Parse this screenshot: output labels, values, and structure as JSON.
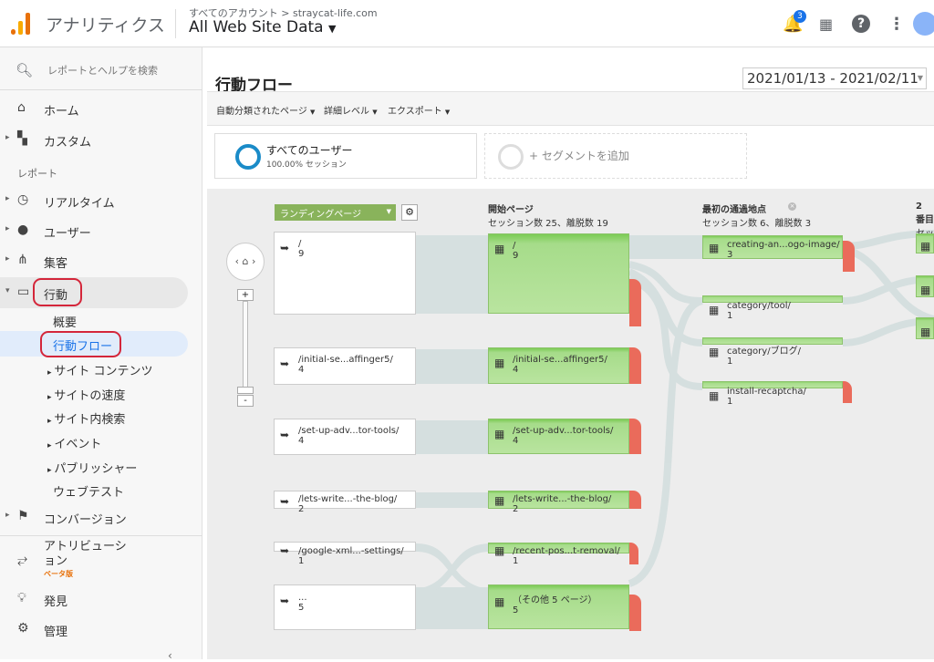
{
  "header": {
    "app_title": "アナリティクス",
    "account_path": "すべてのアカウント > straycat-life.com",
    "property": "All Web Site Data",
    "notification_count": "3"
  },
  "sidebar": {
    "search_placeholder": "レポートとヘルプを検索",
    "home": "ホーム",
    "custom": "カスタム",
    "reports_heading": "レポート",
    "realtime": "リアルタイム",
    "audience": "ユーザー",
    "acquisition": "集客",
    "behavior": "行動",
    "behavior_sub": [
      "概要",
      "行動フロー",
      "サイト コンテンツ",
      "サイトの速度",
      "サイト内検索",
      "イベント",
      "パブリッシャー",
      "ウェブテスト"
    ],
    "conversions": "コンバージョン",
    "attribution": "アトリビューション",
    "attribution_badge": "ベータ版",
    "discover": "発見",
    "admin": "管理"
  },
  "page": {
    "title": "行動フロー",
    "date_range": "2021/01/13 - 2021/02/11"
  },
  "toolbar": {
    "auto_pages": "自動分類されたページ",
    "detail_level": "詳細レベル",
    "export": "エクスポート"
  },
  "segments": {
    "all_users": "すべてのユーザー",
    "all_users_pct": "100.00% セッション",
    "add_segment": "+ セグメントを追加"
  },
  "flow": {
    "landing_dropdown": "ランディングページ",
    "col_start_title": "開始ページ",
    "col_start_stats": "セッション数 25、離脱数 19",
    "col_first_title": "最初の通過地点",
    "col_first_stats": "セッション数 6、離脱数 3",
    "col_second_title": "2 番目",
    "col_second_stats": "セッ",
    "landing_nodes": [
      {
        "label": "/",
        "value": "9"
      },
      {
        "label": "/initial-se...affinger5/",
        "value": "4"
      },
      {
        "label": "/set-up-adv...tor-tools/",
        "value": "4"
      },
      {
        "label": "/lets-write...-the-blog/",
        "value": "2"
      },
      {
        "label": "/google-xml...-settings/",
        "value": "1"
      },
      {
        "label": "...",
        "value": "5"
      }
    ],
    "start_nodes": [
      {
        "label": "/",
        "value": "9"
      },
      {
        "label": "/initial-se...affinger5/",
        "value": "4"
      },
      {
        "label": "/set-up-adv...tor-tools/",
        "value": "4"
      },
      {
        "label": "/lets-write...-the-blog/",
        "value": "2"
      },
      {
        "label": "/recent-pos...t-removal/",
        "value": "1"
      },
      {
        "label": "（その他 5 ページ）",
        "value": "5"
      }
    ],
    "first_nodes": [
      {
        "label": "creating-an...ogo-image/",
        "value": "3"
      },
      {
        "label": "category/tool/",
        "value": "1"
      },
      {
        "label": "category/ブログ/",
        "value": "1"
      },
      {
        "label": "install-recaptcha/",
        "value": "1"
      }
    ]
  }
}
